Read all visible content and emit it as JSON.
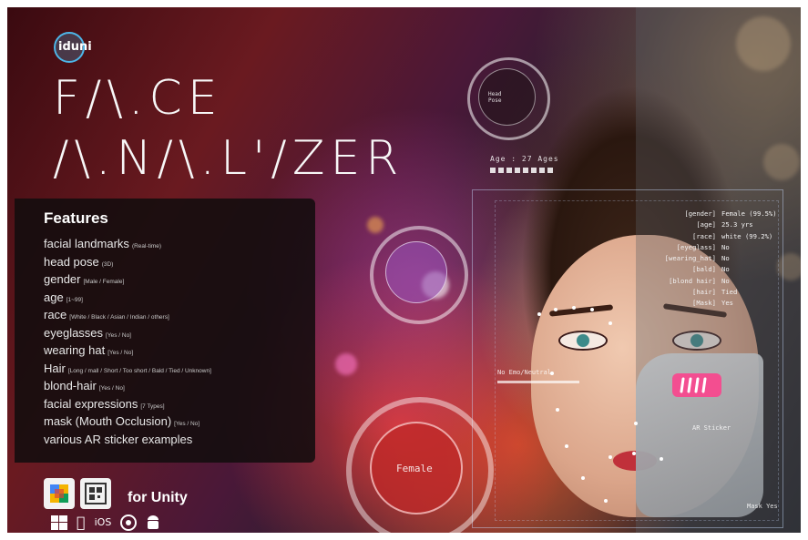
{
  "brand": {
    "logo_text": "iduni",
    "accent": "#4db6e8"
  },
  "title": {
    "line1": "F/\\.CE",
    "line2": "/\\.N/\\.L'/ZER"
  },
  "features": {
    "heading": "Features",
    "items": [
      {
        "label": "facial landmarks",
        "note": "(Real-time)"
      },
      {
        "label": "head pose",
        "note": "(3D)"
      },
      {
        "label": "gender",
        "note": "[Male / Female]"
      },
      {
        "label": "age",
        "note": "[1~99]"
      },
      {
        "label": "race",
        "note": "[White / Black / Asian / Indian / others]"
      },
      {
        "label": "eyeglasses",
        "note": "[Yes / No]"
      },
      {
        "label": "wearing hat",
        "note": "[Yes / No]"
      },
      {
        "label": "Hair",
        "note": "[Long / mall / Short / Too short / Bald / Tied / Unknown]"
      },
      {
        "label": "blond-hair",
        "note": "[Yes / No]"
      },
      {
        "label": "facial expressions",
        "note": "[7 Types]"
      },
      {
        "label": "mask (Mouth Occlusion)",
        "note": "[Yes / No]"
      },
      {
        "label": "various AR sticker examples",
        "note": ""
      }
    ]
  },
  "unity": {
    "label": "for Unity",
    "platforms": [
      "windows-icon",
      "apple-icon",
      "ios-icon",
      "webgl-icon",
      "android-icon"
    ],
    "ios_text": "iOS"
  },
  "hud": {
    "age_label": "Age : 27 Ages",
    "emotion_label": "No Emo/Neutral",
    "gender_label": "Female",
    "ar_sticker_label": "AR Sticker",
    "mask_label": "Mask Yes",
    "stats": [
      {
        "key": "[gender]",
        "value": "Female (99.5%)"
      },
      {
        "key": "[age]",
        "value": "25.3 yrs"
      },
      {
        "key": "[race]",
        "value": "white (99.2%)"
      },
      {
        "key": "[eyeglass]",
        "value": "No"
      },
      {
        "key": "[wearing_hat]",
        "value": "No"
      },
      {
        "key": "[bald]",
        "value": "No"
      },
      {
        "key": "[blond hair]",
        "value": "No"
      },
      {
        "key": "[hair]",
        "value": "Tied"
      },
      {
        "key": "[Mask]",
        "value": "Yes"
      }
    ]
  }
}
